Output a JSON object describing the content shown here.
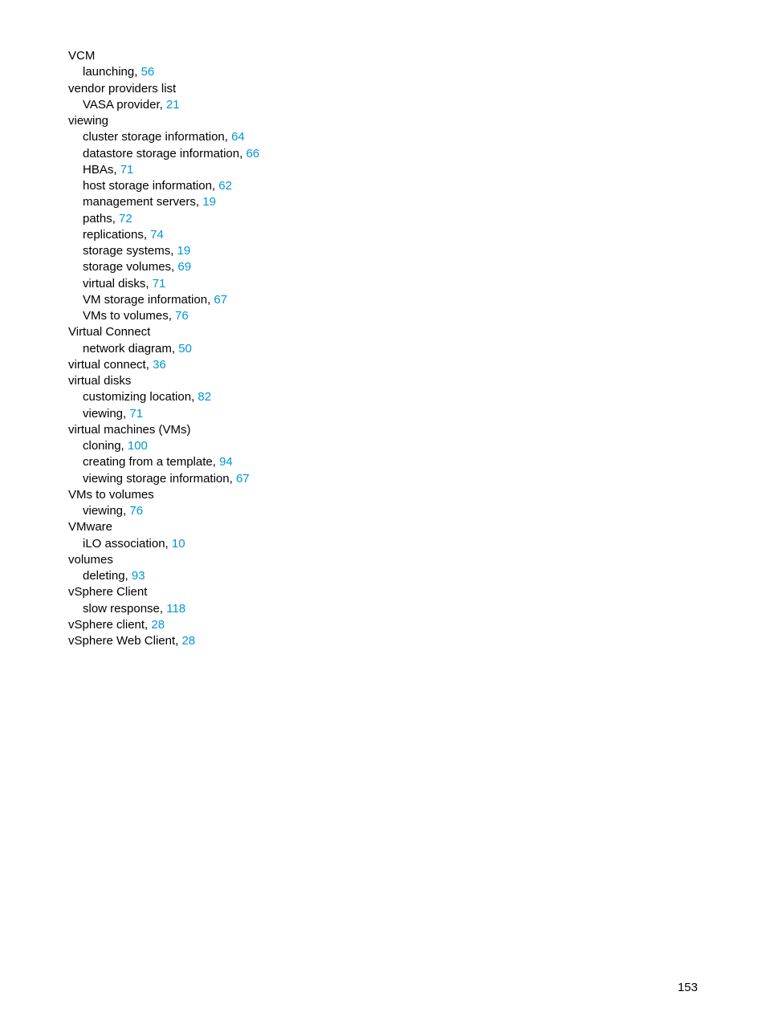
{
  "entries": [
    {
      "level": 1,
      "text": "VCM"
    },
    {
      "level": 2,
      "text": "launching, ",
      "page": "56"
    },
    {
      "level": 1,
      "text": "vendor providers list"
    },
    {
      "level": 2,
      "text": "VASA provider, ",
      "page": "21"
    },
    {
      "level": 1,
      "text": "viewing"
    },
    {
      "level": 2,
      "text": "cluster storage information, ",
      "page": "64"
    },
    {
      "level": 2,
      "text": "datastore storage information, ",
      "page": "66"
    },
    {
      "level": 2,
      "text": "HBAs, ",
      "page": "71"
    },
    {
      "level": 2,
      "text": "host storage information, ",
      "page": "62"
    },
    {
      "level": 2,
      "text": "management servers, ",
      "page": "19"
    },
    {
      "level": 2,
      "text": "paths, ",
      "page": "72"
    },
    {
      "level": 2,
      "text": "replications, ",
      "page": "74"
    },
    {
      "level": 2,
      "text": "storage systems, ",
      "page": "19"
    },
    {
      "level": 2,
      "text": "storage volumes, ",
      "page": "69"
    },
    {
      "level": 2,
      "text": "virtual disks, ",
      "page": "71"
    },
    {
      "level": 2,
      "text": "VM storage information, ",
      "page": "67"
    },
    {
      "level": 2,
      "text": "VMs to volumes, ",
      "page": "76"
    },
    {
      "level": 1,
      "text": "Virtual Connect"
    },
    {
      "level": 2,
      "text": "network diagram, ",
      "page": "50"
    },
    {
      "level": 1,
      "text": "virtual connect, ",
      "page": "36"
    },
    {
      "level": 1,
      "text": "virtual disks"
    },
    {
      "level": 2,
      "text": "customizing location, ",
      "page": "82"
    },
    {
      "level": 2,
      "text": "viewing, ",
      "page": "71"
    },
    {
      "level": 1,
      "text": "virtual machines (VMs)"
    },
    {
      "level": 2,
      "text": "cloning, ",
      "page": "100"
    },
    {
      "level": 2,
      "text": "creating from a template, ",
      "page": "94"
    },
    {
      "level": 2,
      "text": "viewing storage information, ",
      "page": "67"
    },
    {
      "level": 1,
      "text": "VMs to volumes"
    },
    {
      "level": 2,
      "text": "viewing, ",
      "page": "76"
    },
    {
      "level": 1,
      "text": "VMware"
    },
    {
      "level": 2,
      "text": "iLO association, ",
      "page": "10"
    },
    {
      "level": 1,
      "text": "volumes"
    },
    {
      "level": 2,
      "text": "deleting, ",
      "page": "93"
    },
    {
      "level": 1,
      "text": "vSphere Client"
    },
    {
      "level": 2,
      "text": "slow response, ",
      "page": "118"
    },
    {
      "level": 1,
      "text": "vSphere client, ",
      "page": "28"
    },
    {
      "level": 1,
      "text": "vSphere Web Client, ",
      "page": "28"
    }
  ],
  "pageNumber": "153"
}
